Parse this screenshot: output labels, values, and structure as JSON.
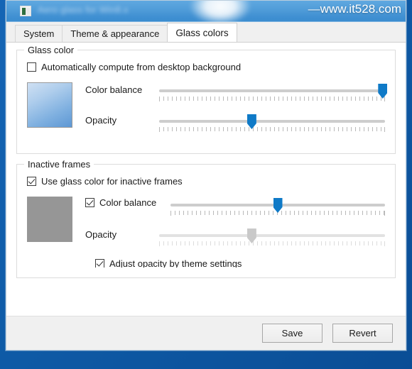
{
  "window": {
    "title": "Aero glass for Win8.x",
    "icon": "app-window-icon",
    "watermark": "www.it528.com",
    "watermark_dash": "—"
  },
  "tabs": [
    {
      "label": "System",
      "active": false
    },
    {
      "label": "Theme & appearance",
      "active": false
    },
    {
      "label": "Glass colors",
      "active": true
    }
  ],
  "glass_color": {
    "legend": "Glass color",
    "auto_compute": {
      "label": "Automatically compute from desktop background",
      "checked": false
    },
    "swatch_color": "#7fb0e0",
    "color_balance": {
      "label": "Color balance",
      "value_percent": 99
    },
    "opacity": {
      "label": "Opacity",
      "value_percent": 41
    }
  },
  "inactive_frames": {
    "legend": "Inactive frames",
    "use_glass_color": {
      "label": "Use glass color for inactive frames",
      "checked": true
    },
    "swatch_color": "#969696",
    "color_balance": {
      "label": "Color balance",
      "checked": true,
      "value_percent": 50
    },
    "opacity": {
      "label": "Opacity",
      "value_percent": 41,
      "disabled": true
    },
    "adjust_opacity": {
      "label": "Adjust opacity by theme settings",
      "checked": true
    }
  },
  "buttons": {
    "save": "Save",
    "revert": "Revert"
  },
  "colors": {
    "accent": "#0f7ac7",
    "titlebar": "#4f9bd8",
    "desktop": "#0f5ca8"
  }
}
